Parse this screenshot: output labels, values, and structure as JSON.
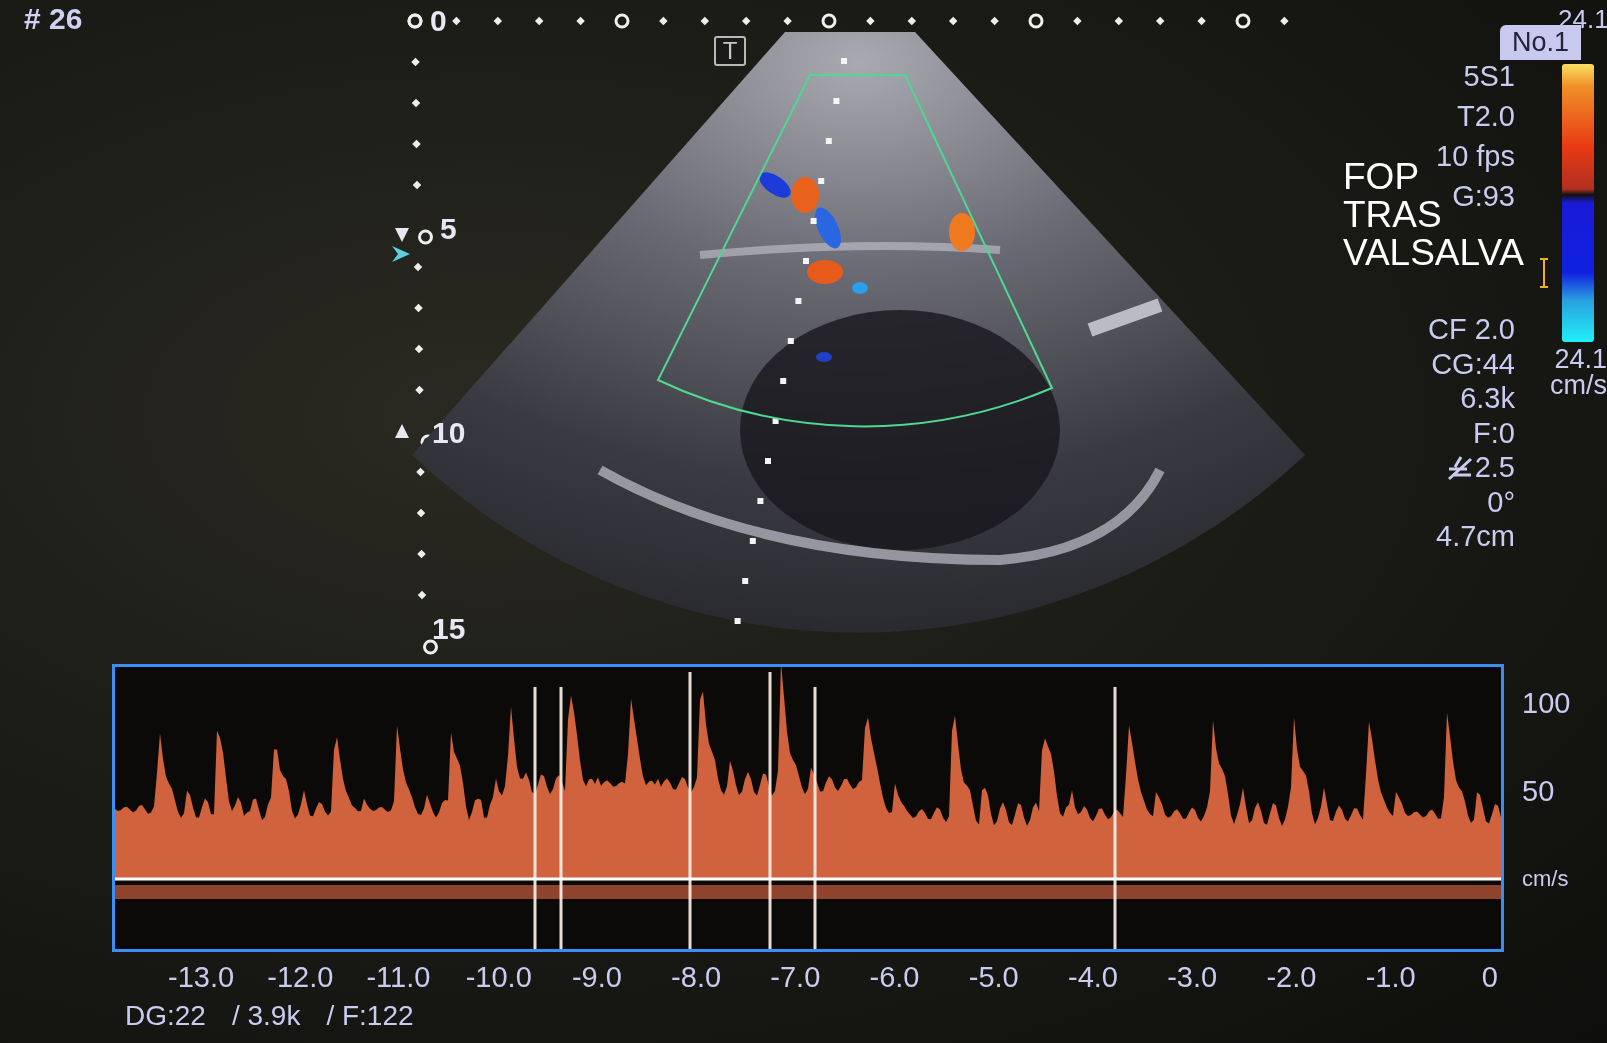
{
  "frame_number": "# 26",
  "depth_scale": [
    "0",
    "5",
    "10",
    "15"
  ],
  "marker_label": "T",
  "probe_badge": "No.1",
  "color_scale": {
    "top_label": "24.1",
    "bottom_label": "24.1",
    "unit": "cm/s"
  },
  "imaging_parameters": [
    {
      "text": "5S1",
      "kind": "plain"
    },
    {
      "text": "T2.0",
      "kind": "plain"
    },
    {
      "text": "10 fps",
      "kind": "plain"
    },
    {
      "text": "G:93",
      "kind": "plain"
    }
  ],
  "color_parameters": [
    {
      "text": "CF 2.0",
      "kind": "plain"
    },
    {
      "text": "CG:44",
      "kind": "plain"
    },
    {
      "text": "6.3k",
      "kind": "plain"
    },
    {
      "text": "F:0",
      "kind": "plain"
    },
    {
      "text": "2.5",
      "kind": "angle"
    },
    {
      "text": "0°",
      "kind": "plain"
    },
    {
      "text": "4.7cm",
      "kind": "plain"
    }
  ],
  "annotation": [
    "FOP",
    "TRAS",
    "VALSALVA"
  ],
  "doppler": {
    "y_labels": [
      "100",
      "50",
      "cm/s"
    ],
    "x_labels": [
      "-13.0",
      "-12.0",
      "-11.0",
      "-10.0",
      "-9.0",
      "-8.0",
      "-7.0",
      "-6.0",
      "-5.0",
      "-4.0",
      "-3.0",
      "-2.0",
      "-1.0",
      "0"
    ]
  },
  "status_bar": [
    "DG:22",
    "/ 3.9k",
    "/ F:122"
  ]
}
